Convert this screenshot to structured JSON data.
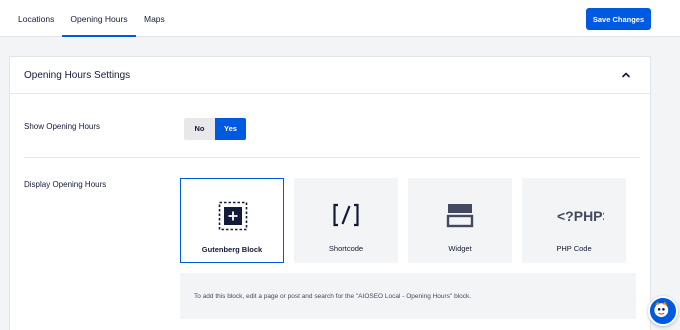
{
  "tabs": [
    {
      "label": "Locations"
    },
    {
      "label": "Opening Hours"
    },
    {
      "label": "Maps"
    }
  ],
  "save_label": "Save Changes",
  "section": {
    "title": "Opening Hours Settings",
    "show_label": "Show Opening Hours",
    "toggle": {
      "no": "No",
      "yes": "Yes",
      "selected": "Yes"
    },
    "display_label": "Display Opening Hours",
    "options": [
      {
        "label": "Gutenberg Block",
        "icon": "gutenberg-block-icon",
        "selected": true
      },
      {
        "label": "Shortcode",
        "icon": "shortcode-icon",
        "selected": false
      },
      {
        "label": "Widget",
        "icon": "widget-icon",
        "selected": false
      },
      {
        "label": "PHP Code",
        "icon": "php-code-icon",
        "selected": false
      }
    ],
    "info": "To add this block, edit a page or post and search for the \"AIOSEO Local - Opening Hours\" block."
  },
  "colors": {
    "accent": "#005ae0",
    "text": "#141b38",
    "panel": "#f3f4f5"
  }
}
